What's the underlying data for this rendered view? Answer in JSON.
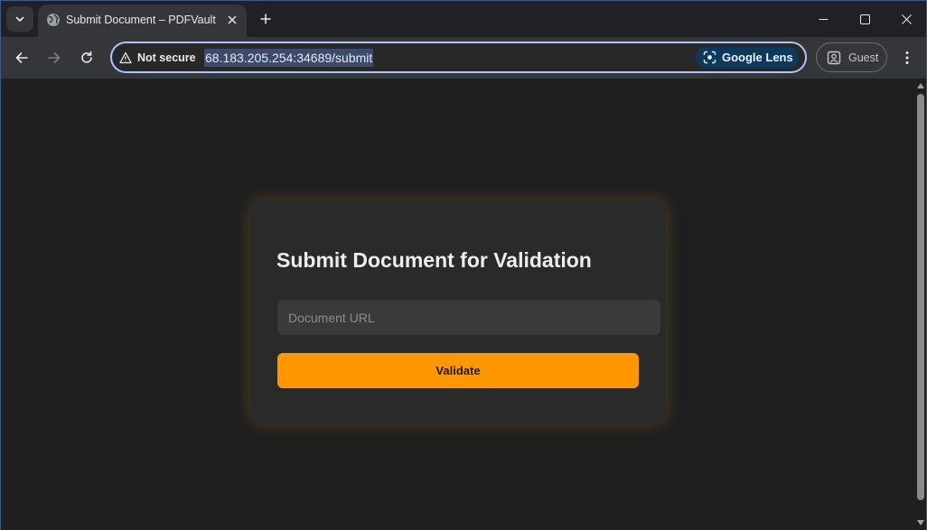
{
  "browser": {
    "tab": {
      "title": "Submit Document – PDFVault"
    },
    "omnibox": {
      "security_label": "Not secure",
      "url": "68.183.205.254:34689/submit",
      "lens_label": "Google Lens"
    },
    "profile_label": "Guest"
  },
  "page": {
    "title": "Submit Document for Validation",
    "url_input": {
      "placeholder": "Document URL",
      "value": ""
    },
    "validate_label": "Validate"
  },
  "colors": {
    "accent": "#ff9800",
    "card_background": "#2a2a2a",
    "page_background": "#1f1f1f"
  },
  "icons": [
    "tab-search-icon",
    "globe-icon",
    "close-icon",
    "plus-icon",
    "minimize-icon",
    "maximize-icon",
    "back-arrow-icon",
    "forward-arrow-icon",
    "reload-icon",
    "warning-icon",
    "lens-icon",
    "profile-icon",
    "kebab-menu-icon"
  ]
}
